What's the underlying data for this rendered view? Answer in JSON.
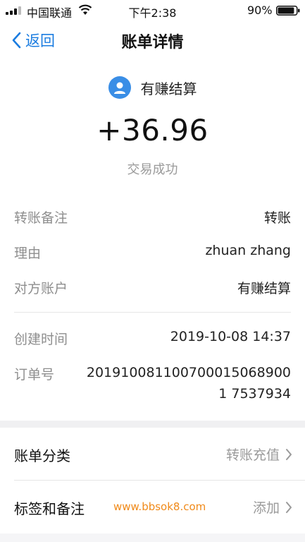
{
  "status_bar": {
    "carrier": "中国联通",
    "time": "下午2:38",
    "battery": "90%",
    "battery_level": 0.9
  },
  "nav": {
    "back_label": "返回",
    "title": "账单详情"
  },
  "summary": {
    "payer": "有赚结算",
    "amount": "+36.96",
    "status": "交易成功"
  },
  "details": {
    "rows": [
      {
        "label": "转账备注",
        "value": "转账"
      },
      {
        "label": "理由",
        "value": "zhuan zhang"
      },
      {
        "label": "对方账户",
        "value": "有赚结算"
      },
      {
        "label": "创建时间",
        "value": "2019-10-08 14:37"
      },
      {
        "label": "订单号",
        "value": "2019100811007000150689001 7537934"
      }
    ]
  },
  "list": {
    "category_label": "账单分类",
    "category_action": "转账充值",
    "tags_label": "标签和备注",
    "tags_action": "添加",
    "watermark": "www.bbsok8.com"
  },
  "colors": {
    "accent": "#1a7ce0",
    "avatar": "#3a8ee6",
    "watermark": "#f08a1a"
  }
}
